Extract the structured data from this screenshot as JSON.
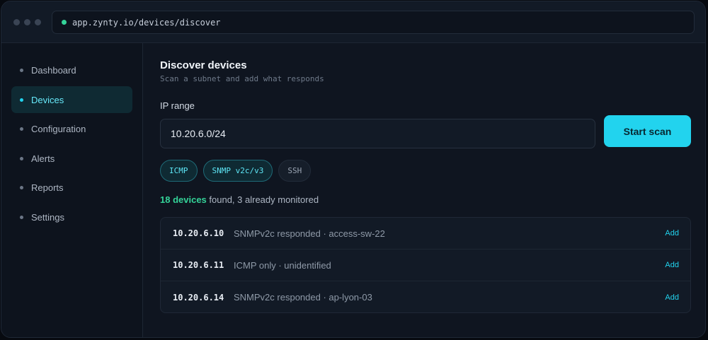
{
  "browser": {
    "url": "app.zynty.io/devices/discover"
  },
  "sidebar": {
    "items": [
      {
        "label": "Dashboard"
      },
      {
        "label": "Devices"
      },
      {
        "label": "Configuration"
      },
      {
        "label": "Alerts"
      },
      {
        "label": "Reports"
      },
      {
        "label": "Settings"
      }
    ],
    "active": "Devices"
  },
  "main": {
    "title": "Discover devices",
    "subtitle": "Scan a subnet and add what responds",
    "ip_label": "IP range",
    "ip_value": "10.20.6.0/24",
    "scan_button": "Start scan",
    "protocols": [
      {
        "label": "ICMP",
        "selected": true
      },
      {
        "label": "SNMP v2c/v3",
        "selected": true
      },
      {
        "label": "SSH",
        "selected": false
      }
    ],
    "status": {
      "count": "18 devices",
      "rest": " found, 3 already monitored"
    },
    "results": [
      {
        "ip": "10.20.6.10",
        "desc": "SNMPv2c responded · access-sw-22",
        "action": "Add"
      },
      {
        "ip": "10.20.6.11",
        "desc": "ICMP only · unidentified",
        "action": "Add"
      },
      {
        "ip": "10.20.6.14",
        "desc": "SNMPv2c responded · ap-lyon-03",
        "action": "Add"
      }
    ]
  },
  "colors": {
    "accent": "#22d3ee",
    "success": "#34d399",
    "background": "#0f1520"
  }
}
